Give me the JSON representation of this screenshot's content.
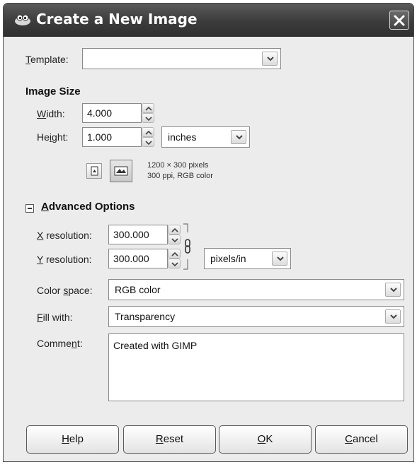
{
  "window": {
    "title": "Create a New Image"
  },
  "template": {
    "label_u": "T",
    "label_rest": "emplate:",
    "value": ""
  },
  "image_size": {
    "title": "Image Size",
    "width_label_pre": "",
    "width_label_u": "W",
    "width_label_post": "idth:",
    "width_value": "4.000",
    "height_label_pre": "He",
    "height_label_u": "i",
    "height_label_post": "ght:",
    "height_value": "1.000",
    "unit": "inches",
    "info_line1": "1200 × 300 pixels",
    "info_line2": "300 ppi, RGB color"
  },
  "advanced": {
    "title_u": "A",
    "title_rest": "dvanced Options",
    "xres_label_u": "X",
    "xres_label_rest": " resolution:",
    "xres_value": "300.000",
    "yres_label_u": "Y",
    "yres_label_rest": " resolution:",
    "yres_value": "300.000",
    "res_unit": "pixels/in",
    "colorspace_label_pre": "Color ",
    "colorspace_label_u": "s",
    "colorspace_label_post": "pace:",
    "colorspace_value": "RGB color",
    "fill_label_u": "F",
    "fill_label_rest": "ill with:",
    "fill_value": "Transparency",
    "comment_label_pre": "Comme",
    "comment_label_u": "n",
    "comment_label_post": "t:",
    "comment_value": "Created with GIMP"
  },
  "buttons": {
    "help_u": "H",
    "help_rest": "elp",
    "reset_u": "R",
    "reset_rest": "eset",
    "ok_u": "O",
    "ok_rest": "K",
    "cancel_u": "C",
    "cancel_rest": "ancel"
  },
  "icons": [
    "gimp-app-icon",
    "close-icon",
    "dropdown-arrow-icon",
    "spin-up-icon",
    "spin-down-icon",
    "portrait-icon",
    "landscape-icon",
    "chain-link-icon",
    "collapse-icon"
  ]
}
